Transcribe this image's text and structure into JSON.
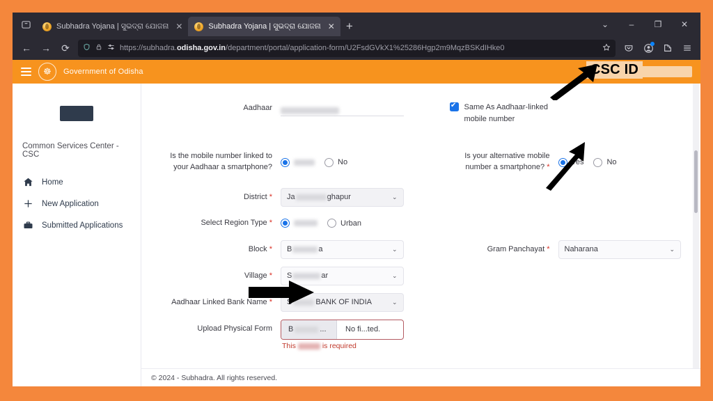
{
  "browser": {
    "list_all_tabs_icon": "list-all-tabs-icon",
    "tabs": [
      {
        "title": "Subhadra Yojana | ସୁଭଦ୍ରା ଯୋଜନା",
        "active": false,
        "close_label": "✕"
      },
      {
        "title": "Subhadra Yojana | ସୁଭଦ୍ରା ଯୋଜନା",
        "active": true,
        "close_label": "✕"
      }
    ],
    "new_tab_label": "+",
    "window_controls": {
      "chevron": "⌄",
      "minimize": "–",
      "maximize": "❐",
      "close": "✕"
    },
    "nav": {
      "back": "←",
      "forward": "→",
      "reload": "⟳"
    },
    "url": {
      "prefix": "https://subhadra.",
      "domain": "odisha.gov.in",
      "path": "/department/portal/application-form/U2FsdGVkX1%25286Hgp2m9MqzBSKdIHke0",
      "shield_icon": "tracking-protection-shield-icon",
      "lock_icon": "lock-icon",
      "permissions_icon": "site-permissions-icon",
      "bookmark_icon": "bookmark-star-icon"
    },
    "toolbar_icons": [
      "pocket-icon",
      "account-icon",
      "extensions-icon",
      "app-menu-icon"
    ]
  },
  "site": {
    "header": {
      "menu_icon": "hamburger-menu-icon",
      "emblem_icon": "odisha-emblem-icon",
      "title": "Government of Odisha",
      "account_icon": "user-account-icon"
    },
    "sidebar": {
      "logo_redacted": "csc-logo-redacted",
      "org_name": "Common Services Center - CSC",
      "items": [
        {
          "label": "Home",
          "icon": "home-icon"
        },
        {
          "label": "New Application",
          "icon": "plus-icon"
        },
        {
          "label": "Submitted Applications",
          "icon": "briefcase-icon"
        }
      ]
    },
    "form": {
      "aadhaar": {
        "label": "Aadhaar",
        "value_redacted": true
      },
      "same_as_aadhaar_mobile": {
        "label_line1": "Same As Aadhaar-linked",
        "label_line2": "mobile number",
        "checked": true
      },
      "mobile_smartphone": {
        "label_line1": "Is the mobile number linked to",
        "label_line2": "your Aadhaar a smartphone?",
        "options": [
          {
            "label": "Yes",
            "selected": true,
            "redacted": true
          },
          {
            "label": "No",
            "selected": false,
            "redacted": false
          }
        ]
      },
      "alt_mobile_smartphone": {
        "label_line1": "Is your alternative mobile",
        "label_line2": "number a smartphone?",
        "required": true,
        "options": [
          {
            "label": "Yes",
            "selected": true
          },
          {
            "label": "No",
            "selected": false
          }
        ]
      },
      "district": {
        "label": "District",
        "required": true,
        "value_prefix": "Ja",
        "value_suffix": "ghapur",
        "chevron": "⌄"
      },
      "region_type": {
        "label": "Select Region Type",
        "required": true,
        "options": [
          {
            "label": "Rural",
            "selected": true,
            "redacted": true
          },
          {
            "label": "Urban",
            "selected": false,
            "redacted": false
          }
        ]
      },
      "block": {
        "label": "Block",
        "required": true,
        "value_prefix": "B",
        "value_suffix": "a",
        "chevron": "⌄"
      },
      "gram_panchayat": {
        "label": "Gram Panchayat",
        "required": true,
        "value": "Naharana",
        "chevron": "⌄"
      },
      "village": {
        "label": "Village",
        "required": true,
        "value_prefix": "S",
        "value_suffix": "ar",
        "chevron": "⌄"
      },
      "bank_name": {
        "label": "Aadhaar Linked Bank Name",
        "required": true,
        "value_prefix": "S",
        "value_suffix": "BANK OF INDIA",
        "chevron": "⌄"
      },
      "upload_physical_form": {
        "label": "Upload Physical Form",
        "browse_label": "B",
        "browse_suffix": "...",
        "file_status": "No fi...ted.",
        "error_prefix": "This",
        "error_suffix": "is required"
      }
    },
    "footer": {
      "text": "© 2024 - Subhadra. All rights reserved."
    },
    "scrollbar": {
      "name": "page-scrollbar"
    }
  },
  "annotations": {
    "csc_id_label": "CSC ID",
    "arrows": [
      {
        "name": "arrow-to-csc-id"
      },
      {
        "name": "arrow-to-alt-mobile-smartphone-yes"
      },
      {
        "name": "arrow-to-upload-physical-form"
      }
    ]
  },
  "colors": {
    "brand_orange": "#f7931e",
    "frame_orange": "#f4873c",
    "accent_blue": "#1a73e8",
    "error_red": "#c0392b",
    "chrome_dark": "#2b2a33",
    "annotation_bg": "#f8d4ab"
  }
}
